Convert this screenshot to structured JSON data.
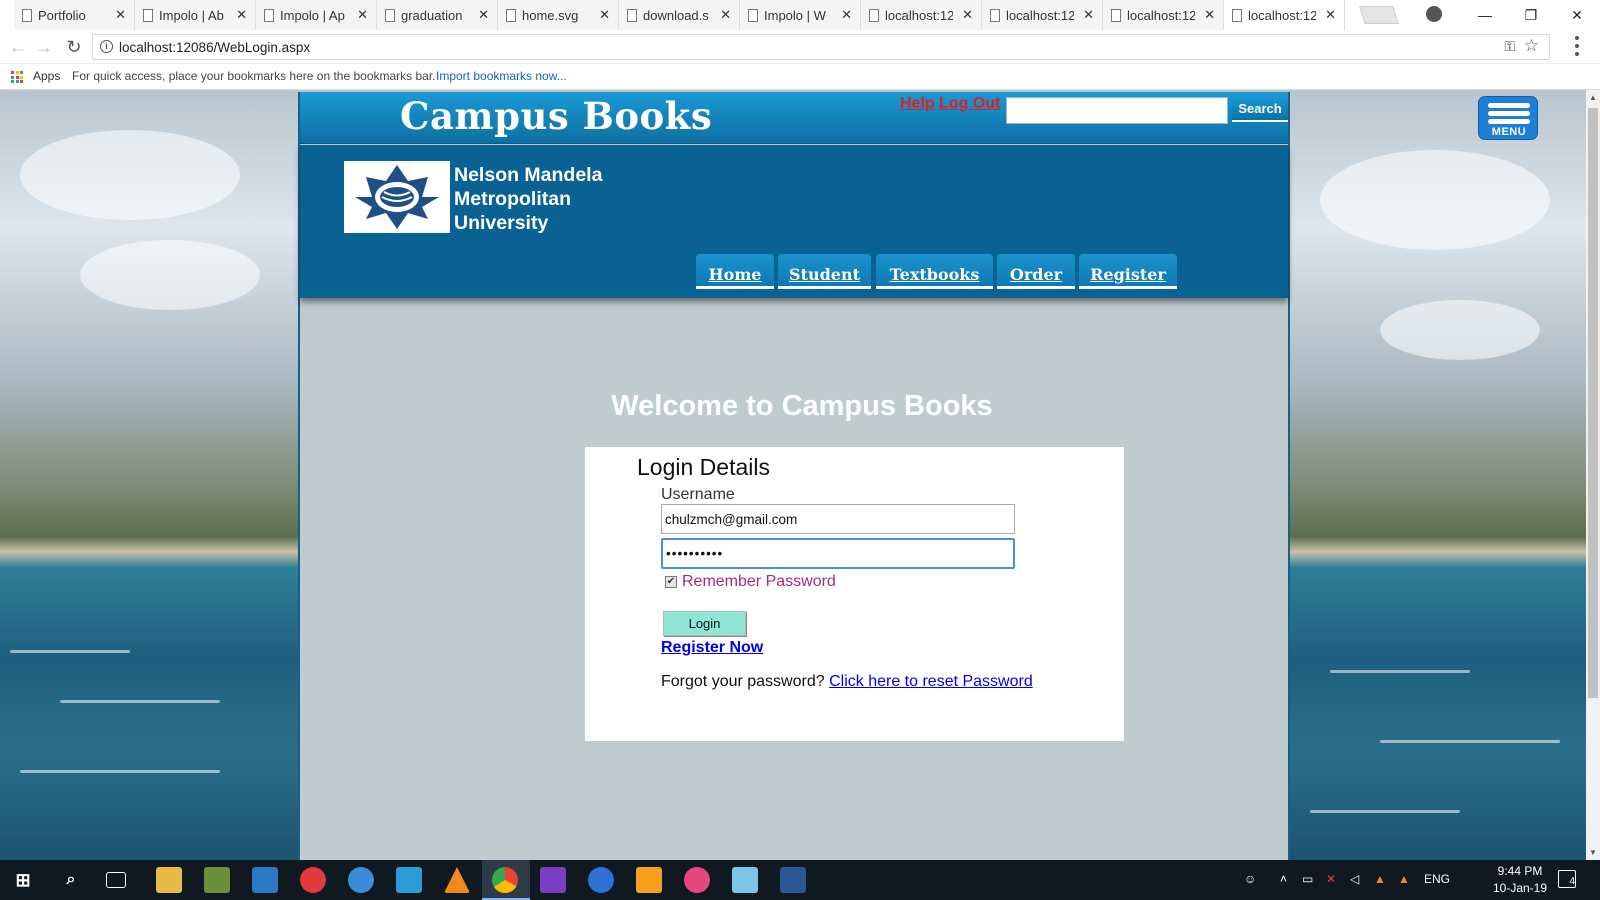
{
  "browser": {
    "tabs": [
      {
        "label": "Portfolio"
      },
      {
        "label": "Impolo | Ab"
      },
      {
        "label": "Impolo | Ap"
      },
      {
        "label": "graduation"
      },
      {
        "label": "home.svg"
      },
      {
        "label": "download.s"
      },
      {
        "label": "Impolo | W"
      },
      {
        "label": "localhost:12"
      },
      {
        "label": "localhost:12"
      },
      {
        "label": "localhost:12"
      },
      {
        "label": "localhost:12"
      }
    ],
    "url": "localhost:12086/WebLogin.aspx",
    "bookmarks": {
      "apps_label": "Apps",
      "hint": "For quick access, place your bookmarks here on the bookmarks bar.",
      "import_label": "Import bookmarks now..."
    }
  },
  "site": {
    "brand": "Campus Books",
    "help_label": "Help",
    "logout_label": "Log Out",
    "search_label": "Search",
    "search_value": "",
    "university_lines": [
      "Nelson Mandela",
      "Metropolitan",
      "University"
    ],
    "nav": [
      "Home",
      "Student",
      "Textbooks",
      "Order",
      "Register"
    ],
    "menu_label": "MENU"
  },
  "login": {
    "welcome": "Welcome to Campus Books",
    "title": "Login Details",
    "username_label": "Username",
    "username_value": "chulzmch@gmail.com",
    "password_value": "••••••••••",
    "remember_label": "Remember Password",
    "remember_checked": true,
    "login_label": "Login",
    "register_label": "Register Now",
    "forgot_text": "Forgot your password?",
    "reset_label": "Click here to reset Password"
  },
  "taskbar": {
    "lang": "ENG",
    "time": "9:44 PM",
    "date": "10-Jan-19",
    "notification_count": "4"
  },
  "colors": {
    "header_blue": "#0a6194",
    "brand_blue": "#1a9ad4",
    "login_button": "#8fe6d2",
    "link_red": "#e51e1e",
    "remember_text": "#a22c7c"
  }
}
